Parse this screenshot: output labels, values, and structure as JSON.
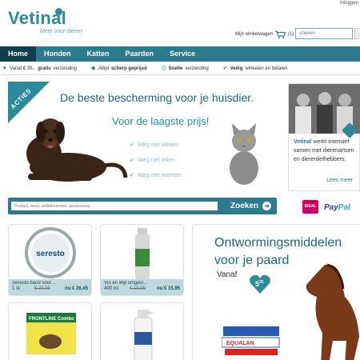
{
  "header": {
    "login_link": "Inloggen",
    "logo_text": "Vetinal",
    "tagline": "Meer voor dieren",
    "cart_label": "Mijn winkelwagen",
    "cart_count": "(1)",
    "search_placeholder": "Zoeken"
  },
  "nav": {
    "items": [
      {
        "label": "Home",
        "active": true
      },
      {
        "label": "Honden"
      },
      {
        "label": "Katten"
      },
      {
        "label": "Paarden"
      },
      {
        "label": "Service"
      }
    ]
  },
  "usp": [
    {
      "prefix": "Vanaf € 35,-",
      "bold": "gratis",
      "suffix": "verzending"
    },
    {
      "prefix": "Altijd",
      "bold": "scherp geprijsd",
      "suffix": ""
    },
    {
      "prefix": "",
      "bold": "Snelle",
      "suffix": "verzending"
    },
    {
      "prefix": "",
      "bold": "Veilig",
      "suffix": "winkelen en betalen"
    }
  ],
  "hero": {
    "badge": "ACTIES",
    "title": "De beste bescherming voor je huisdier.",
    "subtitle": "Voor de laagste prijs!",
    "checks": [
      "Weg met vlooien",
      "Weg met teken",
      "Weg met wormen"
    ]
  },
  "side_card": {
    "text_bold": "Vetinal",
    "text": "werkt intensief samen met dierenartsen en dierenliefhebbers.",
    "more": "Lees meer"
  },
  "search": {
    "placeholder": "Product, merk, artikelnummer, aandoening...",
    "button": "Zoeken"
  },
  "payment": {
    "ideal": "iDEAL",
    "paypal_a": "Pay",
    "paypal_b": "Pal"
  },
  "products": [
    {
      "name": "Seresto band voor ...",
      "size": "1 st",
      "old_price": "€ 29,95",
      "new_price": "nu € 26,45",
      "brand": "seresto"
    },
    {
      "name": "Vlo en Mijt omgevi...",
      "size": "400 ml",
      "old_price": "€ 19,95",
      "new_price": "nu € 15,95"
    },
    {
      "name": "",
      "brand": "FRONTLINE Combo"
    },
    {
      "name": ""
    }
  ],
  "horse_promo": {
    "title": "Ontwormingsmiddelen voor je paard",
    "vanaf": "Vanaf",
    "price_main": "5",
    "price_cents": "25",
    "product_label": "EQUALAN"
  },
  "colors": {
    "brand": "#2c8a9b",
    "nav": "#2c7a8c",
    "nav_active": "#0f3f4a",
    "card_bottom": "#bcd9e0"
  }
}
